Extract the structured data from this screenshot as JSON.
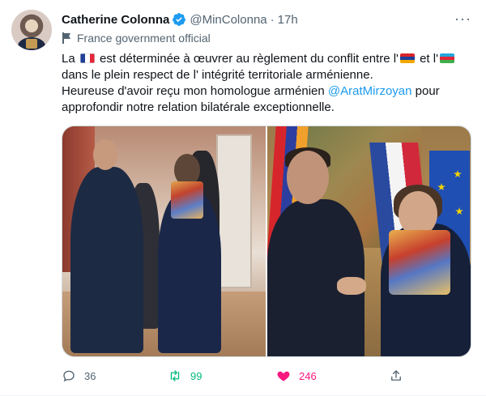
{
  "tweet": {
    "author_name": "Catherine Colonna",
    "handle": "@MinColonna",
    "separator": "·",
    "time": "17h",
    "label": "France government official",
    "text": {
      "line1_a": "La",
      "line1_b": "est déterminée à œuvrer au règlement du conflit entre l'",
      "line1_c": "et l'",
      "line2": "dans le plein respect de l' intégrité territoriale arménienne.",
      "line3_a": "Heureuse d'avoir reçu mon homologue arménien",
      "line3_mention": "@AratMirzoyan",
      "line3_b": "pour",
      "line4": "approfondir notre relation bilatérale exceptionnelle."
    },
    "emojis": [
      "flag-france",
      "flag-armenia",
      "flag-azerbaijan"
    ],
    "media_count": 2
  },
  "actions": {
    "replies": "36",
    "retweets": "99",
    "likes": "246"
  },
  "colors": {
    "accent": "#1d9bf0",
    "retweet": "#00ba7c",
    "like": "#f91880",
    "muted": "#536471"
  }
}
